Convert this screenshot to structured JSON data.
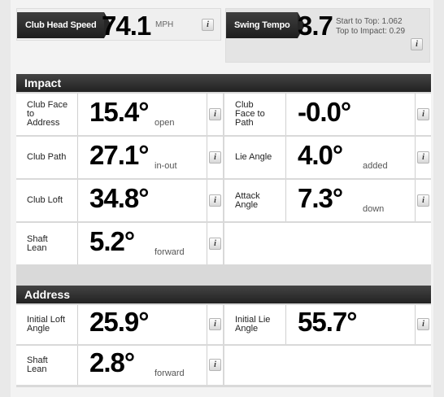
{
  "club_head_speed": {
    "label": "Club Head Speed",
    "value": "74.1",
    "unit": "MPH",
    "info": "i"
  },
  "swing_tempo": {
    "label": "Swing Tempo",
    "value": "3.7",
    "start_to_top": "Start to Top: 1.062",
    "top_to_impact": "Top to Impact: 0.29",
    "info": "i"
  },
  "impact": {
    "title": "Impact",
    "cells": [
      {
        "label": [
          "Club Face",
          "to",
          "Address"
        ],
        "value": "15.4°",
        "unit": "open"
      },
      {
        "label": [
          "Club",
          "Face to",
          "Path"
        ],
        "value": "-0.0°",
        "unit": ""
      },
      {
        "label": [
          "Club Path"
        ],
        "value": "27.1°",
        "unit": "in-out"
      },
      {
        "label": [
          "Lie Angle"
        ],
        "value": "4.0°",
        "unit": "added"
      },
      {
        "label": [
          "Club Loft"
        ],
        "value": "34.8°",
        "unit": ""
      },
      {
        "label": [
          "Attack",
          "Angle"
        ],
        "value": "7.3°",
        "unit": "down"
      },
      {
        "label": [
          "Shaft",
          "Lean"
        ],
        "value": "5.2°",
        "unit": "forward"
      }
    ]
  },
  "address": {
    "title": "Address",
    "cells": [
      {
        "label": [
          "Initial Loft",
          "Angle"
        ],
        "value": "25.9°",
        "unit": ""
      },
      {
        "label": [
          "Initial Lie",
          "Angle"
        ],
        "value": "55.7°",
        "unit": ""
      },
      {
        "label": [
          "Shaft",
          "Lean"
        ],
        "value": "2.8°",
        "unit": "forward"
      }
    ]
  },
  "info_glyph": "i"
}
